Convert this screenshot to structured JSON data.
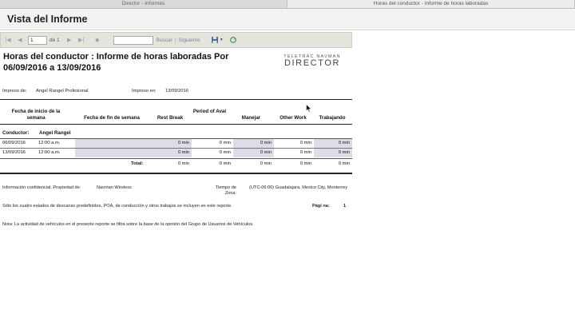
{
  "tabs": [
    {
      "label": "Director - Informes",
      "active": false
    },
    {
      "label": "Horas del conductor - Informe de horas laboradas",
      "active": true
    }
  ],
  "header": {
    "title": "Vista del Informe"
  },
  "toolbar": {
    "page_value": "1",
    "page_of": "de 1",
    "search_value": "",
    "search_label": "Buscar",
    "separator": "|",
    "next_label": "Siguiente"
  },
  "report": {
    "title": "Horas del conductor : Informe de horas laboradas Por 06/09/2016 a 13/09/2016",
    "logo": {
      "line1": "TELETRAC NAVMAN",
      "line2": "DIRECTOR"
    },
    "printed_by_label": "Impreso de:",
    "printed_by_value": "Angel Rangel Profesional",
    "printed_on_label": "Impreso en:",
    "printed_on_value": "13/09/2016",
    "columns": {
      "start": "Fecha de inicio de la semana",
      "end": "Fecha de fin de semana",
      "rest": "Rest Break",
      "aval": "Period of Aval",
      "drive": "Manejar",
      "other": "Other Work",
      "work": "Trabajando"
    },
    "driver_label": "Conductor:",
    "driver_name": "Angel Rangel",
    "rows": [
      {
        "date": "06/09/2016",
        "time": "12:00 a.m.",
        "end": "",
        "rest": "0 min",
        "aval": "0 min",
        "drive": "0 min",
        "other": "0 min",
        "work": "0 min"
      },
      {
        "date": "13/09/2016",
        "time": "12:00 a.m.",
        "end": "",
        "rest": "0 min",
        "aval": "0 min",
        "drive": "0 min",
        "other": "0 min",
        "work": "0 min"
      }
    ],
    "total": {
      "label": "Total:",
      "rest": "0 min",
      "aval": "0 min",
      "drive": "0 min",
      "other": "0 min",
      "work": "0 min"
    },
    "footer": {
      "confidential_label": "Información confidencial. Propiedad de:",
      "confidential_value": "Navman Wireless",
      "timezone_label": "Tiempo de Zona:",
      "timezone_value": "(UTC-06:00) Guadalajara, Mexico City, Monterrey",
      "note1": "Sólo los cuatro estados de descanso predefinidos, POA, de conducción y otros trabajos se incluyen en este reporte.",
      "page_label": "Pági na:",
      "page_value": "1",
      "note2": "Nota: La actividad de vehículos en el presente reporte se filtra sobre la base de la opinión del Grupo de Usuarios de Vehículos."
    }
  }
}
